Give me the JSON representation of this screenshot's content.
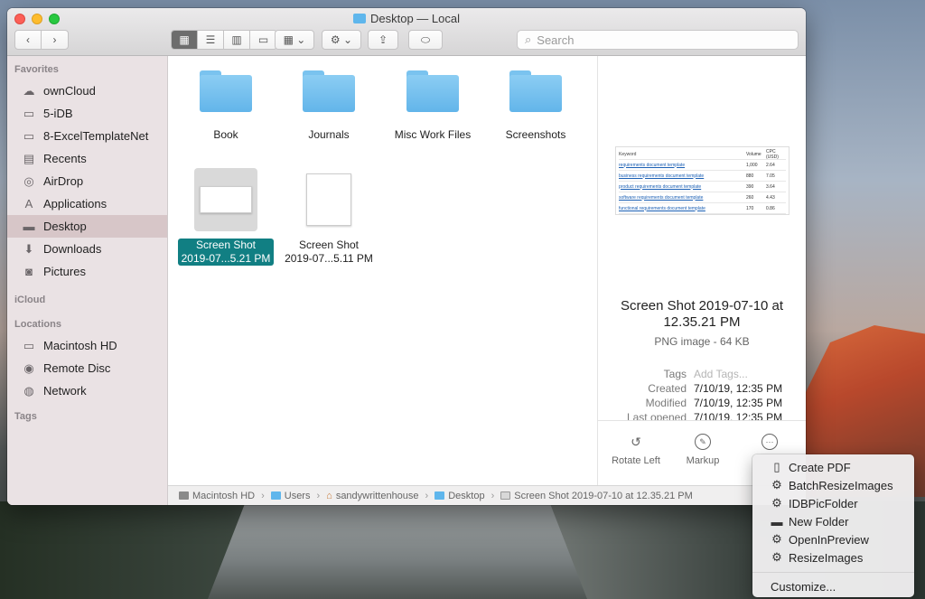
{
  "window": {
    "title": "Desktop — Local"
  },
  "toolbar": {
    "search_placeholder": "Search"
  },
  "sidebar": {
    "favorites_header": "Favorites",
    "favorites": [
      {
        "label": "ownCloud",
        "icon": "cloud-icon"
      },
      {
        "label": "5-iDB",
        "icon": "folder-icon"
      },
      {
        "label": "8-ExcelTemplateNet",
        "icon": "folder-icon"
      },
      {
        "label": "Recents",
        "icon": "recents-icon"
      },
      {
        "label": "AirDrop",
        "icon": "airdrop-icon"
      },
      {
        "label": "Applications",
        "icon": "applications-icon"
      },
      {
        "label": "Desktop",
        "icon": "desktop-icon",
        "selected": true
      },
      {
        "label": "Downloads",
        "icon": "downloads-icon"
      },
      {
        "label": "Pictures",
        "icon": "camera-icon"
      }
    ],
    "icloud_header": "iCloud",
    "locations_header": "Locations",
    "locations": [
      {
        "label": "Macintosh HD",
        "icon": "disk-icon"
      },
      {
        "label": "Remote Disc",
        "icon": "disc-icon"
      },
      {
        "label": "Network",
        "icon": "globe-icon"
      }
    ],
    "tags_header": "Tags"
  },
  "files": [
    {
      "name": "Book",
      "kind": "folder"
    },
    {
      "name": "Journals",
      "kind": "folder"
    },
    {
      "name": "Misc Work Files",
      "kind": "folder"
    },
    {
      "name": "Screenshots",
      "kind": "folder"
    },
    {
      "name_line1": "Screen Shot",
      "name_line2": "2019-07...5.21 PM",
      "kind": "image",
      "selected": true
    },
    {
      "name_line1": "Screen Shot",
      "name_line2": "2019-07...5.11 PM",
      "kind": "image"
    }
  ],
  "preview": {
    "thumb": {
      "headers": [
        "Keyword",
        "Volume",
        "CPC (USD)"
      ],
      "rows": [
        [
          "requirements document template",
          "1,000",
          "2.64"
        ],
        [
          "business requirements document template",
          "880",
          "7.05"
        ],
        [
          "product requirements document template",
          "390",
          "3.64"
        ],
        [
          "software requirements document template",
          "260",
          "4.43"
        ],
        [
          "functional requirements document template",
          "170",
          "0.86"
        ]
      ]
    },
    "name_line1": "Screen Shot 2019-07-10 at",
    "name_line2": "12.35.21 PM",
    "kind": "PNG image - 64 KB",
    "tags_label": "Tags",
    "tags_placeholder": "Add Tags...",
    "created_label": "Created",
    "created_value": "7/10/19, 12:35 PM",
    "modified_label": "Modified",
    "modified_value": "7/10/19, 12:35 PM",
    "opened_label": "Last opened",
    "opened_value": "7/10/19, 12:35 PM",
    "actions": {
      "rotate": "Rotate Left",
      "markup": "Markup"
    }
  },
  "pathbar": [
    "Macintosh HD",
    "Users",
    "sandywrittenhouse",
    "Desktop",
    "Screen Shot 2019-07-10 at 12.35.21 PM"
  ],
  "menu": {
    "items": [
      {
        "label": "Create PDF",
        "icon": "pdf-icon"
      },
      {
        "label": "BatchResizeImages",
        "icon": "gear-icon"
      },
      {
        "label": "IDBPicFolder",
        "icon": "gear-icon"
      },
      {
        "label": "New Folder",
        "icon": "folder-icon"
      },
      {
        "label": "OpenInPreview",
        "icon": "gear-icon"
      },
      {
        "label": "ResizeImages",
        "icon": "gear-icon"
      }
    ],
    "customize": "Customize..."
  }
}
